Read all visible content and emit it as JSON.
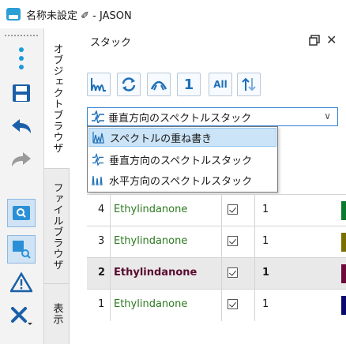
{
  "window": {
    "title": "名称未設定 ✐ - JASON"
  },
  "vertical_tabs": [
    "オブジェクトブラウザ",
    "ファイルブラウザ",
    "表示"
  ],
  "panel": {
    "title": "スタック",
    "float_icon": "float-window-icon",
    "close_label": "✕",
    "toolbar_icons": [
      "stack-overlay-icon",
      "refresh-icon",
      "stack-offset-icon",
      "1",
      "All",
      "sort-icon"
    ],
    "toolbar_text": {
      "one": "1",
      "all": "All"
    }
  },
  "combo": {
    "selected": "垂直方向のスペクトルスタック",
    "arrow": "∨"
  },
  "dropdown": {
    "options": [
      {
        "label": "スペクトルの重ね書き",
        "icon": "overlay-spectra-icon",
        "highlighted": true
      },
      {
        "label": "垂直方向のスペクトルスタック",
        "icon": "vertical-stack-icon",
        "highlighted": false
      },
      {
        "label": "水平方向のスペクトルスタック",
        "icon": "horizontal-stack-icon",
        "highlighted": false
      }
    ]
  },
  "table": {
    "rows": [
      {
        "index": "4",
        "name": "Ethylindanone",
        "checked": true,
        "value": "1",
        "color": "#0a7a2e",
        "selected": false
      },
      {
        "index": "3",
        "name": "Ethylindanone",
        "checked": true,
        "value": "1",
        "color": "#7a6e00",
        "selected": false
      },
      {
        "index": "2",
        "name": "Ethylindanone",
        "checked": true,
        "value": "1",
        "color": "#6e0a3c",
        "selected": true
      },
      {
        "index": "1",
        "name": "Ethylindanone",
        "checked": true,
        "value": "1",
        "color": "#0a0a6e",
        "selected": false
      }
    ]
  },
  "colors": {
    "accent": "#2f7fd0",
    "name_text": "#2b7a1f",
    "highlight": "#cce4f7"
  }
}
